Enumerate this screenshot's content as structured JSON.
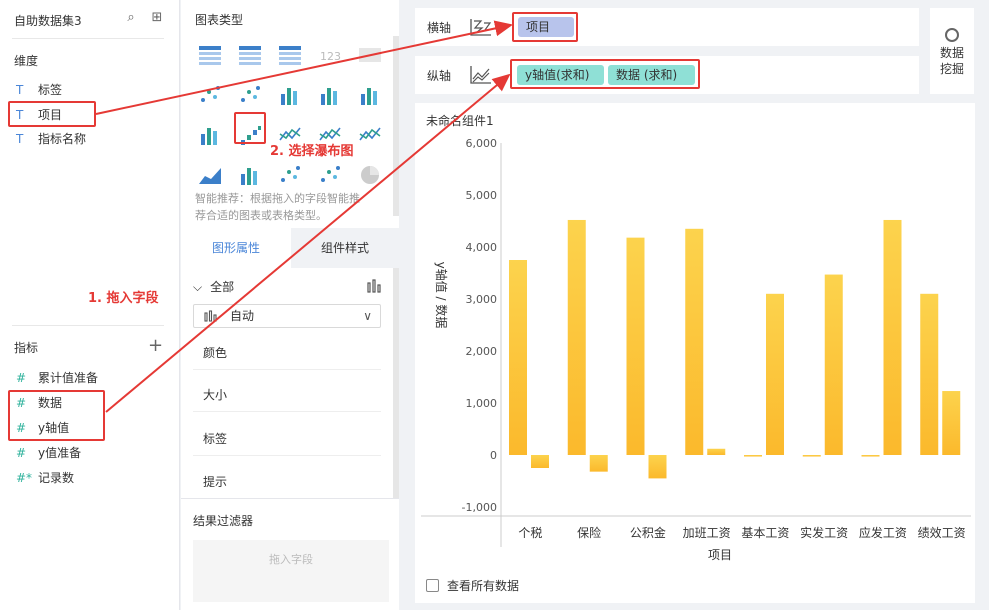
{
  "left": {
    "title": "自助数据集3",
    "dimension_header": "维度",
    "dimensions": [
      {
        "type": "T",
        "label": "标签"
      },
      {
        "type": "T",
        "label": "项目"
      },
      {
        "type": "T",
        "label": "指标名称"
      }
    ],
    "measure_header": "指标",
    "measures": [
      {
        "type": "#",
        "label": "累计值准备"
      },
      {
        "type": "#",
        "label": "数据"
      },
      {
        "type": "#",
        "label": "y轴值"
      },
      {
        "type": "#",
        "label": "y值准备"
      },
      {
        "type": "#*",
        "label": "记录数"
      }
    ]
  },
  "middle": {
    "title": "图表类型",
    "tip": "智能推荐：根据拖入的字段智能推荐合适的图表或表格类型。",
    "tab_shape": "图形属性",
    "tab_style": "组件样式",
    "all_label": "全部",
    "select_value": "自动",
    "props": [
      "颜色",
      "大小",
      "标签",
      "提示"
    ],
    "filter_title": "结果过滤器",
    "filter_placeholder": "拖入字段"
  },
  "axes": {
    "x_label": "横轴",
    "y_label": "纵轴",
    "x_fields": [
      "项目"
    ],
    "y_fields": [
      "y轴值(求和)",
      "数据  (求和)"
    ]
  },
  "mining": {
    "line1": "数据",
    "line2": "挖掘"
  },
  "card": {
    "title": "未命名组件1",
    "show_all": "查看所有数据"
  },
  "annotations": {
    "step1": "1. 拖入字段",
    "step2": "2. 选择瀑布图"
  },
  "colors": {
    "bar": "#fcc43c",
    "accent": "#4a86d8",
    "annot": "#e53935",
    "pill_x": "#b8c4ec",
    "pill_y": "#8fe0d6"
  },
  "chart_data": {
    "type": "bar",
    "categories": [
      "个税",
      "保险",
      "公积金",
      "加班工资",
      "基本工资",
      "实发工资",
      "应发工资",
      "绩效工资"
    ],
    "series": [
      {
        "values": [
          3750,
          4520,
          4180,
          4350,
          0,
          0,
          0,
          3100
        ]
      },
      {
        "values": [
          -250,
          -320,
          -450,
          120,
          3100,
          3470,
          4520,
          1230
        ]
      }
    ],
    "ylabel": "y轴值 / 数据",
    "xlabel": "项目",
    "ylim": [
      -1000,
      6000
    ],
    "yticks": [
      "-1,000",
      "0",
      "1,000",
      "2,000",
      "3,000",
      "4,000",
      "5,000",
      "6,000"
    ],
    "grid": false
  }
}
